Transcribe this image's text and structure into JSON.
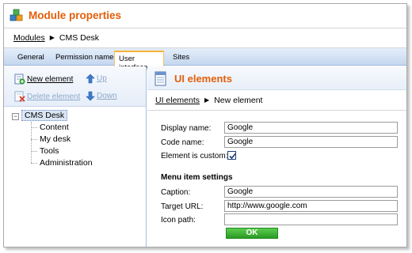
{
  "window": {
    "title": "Module properties"
  },
  "breadcrumb": {
    "root": "Modules",
    "current": "CMS Desk"
  },
  "tabs": [
    {
      "label": "General"
    },
    {
      "label": "Permission names"
    },
    {
      "label": "User interface",
      "active": true
    },
    {
      "label": "Sites"
    }
  ],
  "toolbar": {
    "new_element": "New element",
    "up": "Up",
    "delete_element": "Delete element",
    "down": "Down"
  },
  "tree": {
    "root": "CMS Desk",
    "children": [
      "Content",
      "My desk",
      "Tools",
      "Administration"
    ]
  },
  "panel": {
    "title": "UI elements",
    "breadcrumb_root": "UI elements",
    "breadcrumb_current": "New element"
  },
  "form": {
    "display_name": {
      "label": "Display name:",
      "value": "Google"
    },
    "code_name": {
      "label": "Code name:",
      "value": "Google"
    },
    "is_custom": {
      "label": "Element is custom:",
      "checked": true
    },
    "section_title": "Menu item settings",
    "caption": {
      "label": "Caption:",
      "value": "Google"
    },
    "target_url": {
      "label": "Target URL:",
      "value": "http://www.google.com"
    },
    "icon_path": {
      "label": "Icon path:",
      "value": ""
    },
    "ok_label": "OK"
  },
  "colors": {
    "title_orange": "#e35f0a",
    "tab_bar": "#c5d7ef",
    "ok_green": "#3aaa30"
  }
}
